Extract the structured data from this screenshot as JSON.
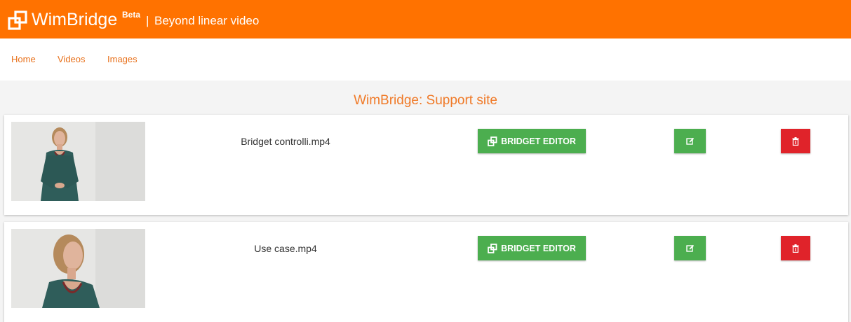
{
  "header": {
    "brand": "WimBridge",
    "badge": "Beta",
    "separator": "|",
    "tagline": "Beyond linear video",
    "bar_color": "#ff7200"
  },
  "nav": {
    "items": [
      {
        "label": "Home"
      },
      {
        "label": "Videos"
      },
      {
        "label": "Images"
      }
    ]
  },
  "main": {
    "title": "WimBridge: Support site",
    "videos": [
      {
        "filename": "Bridget controlli.mp4",
        "editor_label": "BRIDGET EDITOR",
        "edit_icon": "edit-icon",
        "delete_icon": "trash-icon"
      },
      {
        "filename": "Use case.mp4",
        "editor_label": "BRIDGET EDITOR",
        "edit_icon": "edit-icon",
        "delete_icon": "trash-icon"
      }
    ]
  },
  "colors": {
    "accent": "#ff7200",
    "success": "#4cae4f",
    "danger": "#e0232a"
  }
}
